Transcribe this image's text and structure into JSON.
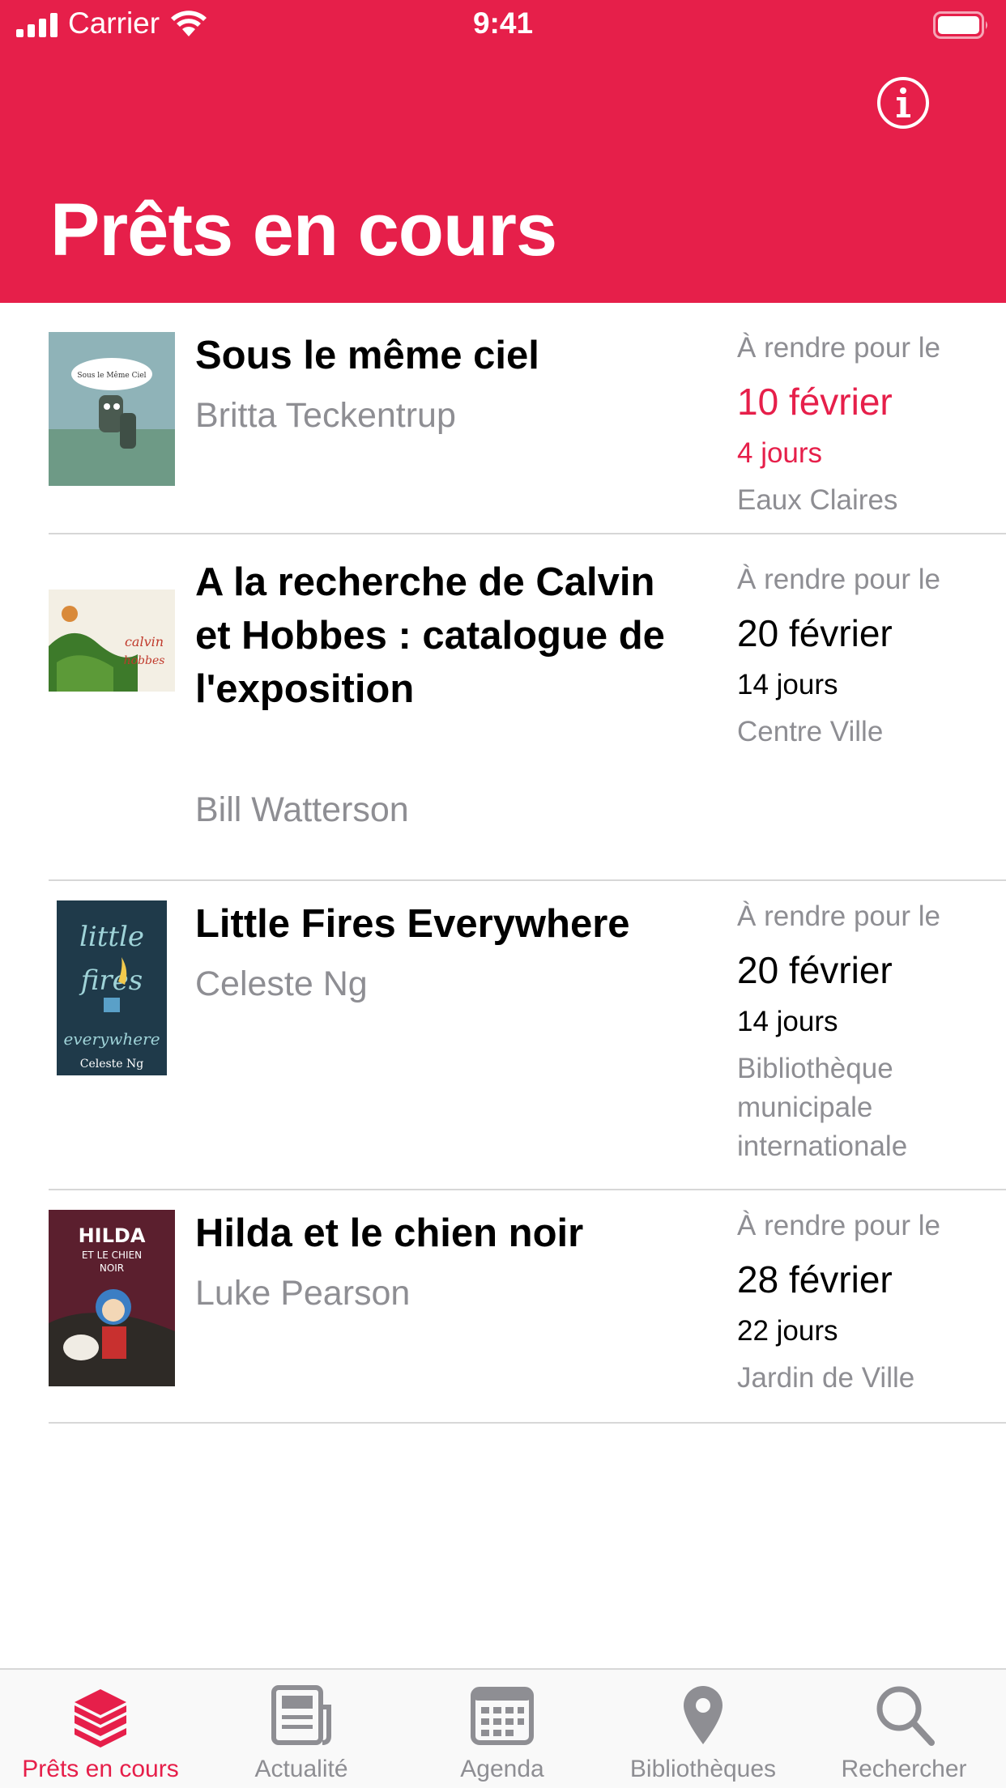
{
  "status_bar": {
    "carrier": "Carrier",
    "time": "9:41"
  },
  "header": {
    "title": "Prêts en cours",
    "info_icon": "info-circle-icon",
    "background": "#e61f4a"
  },
  "loans": [
    {
      "title": "Sous le même ciel",
      "author": "Britta Teckentrup",
      "due_label": "À rendre pour le",
      "due_date": "10 février",
      "due_days": "4 jours",
      "library": "Eaux Claires",
      "urgent": true,
      "cover_text": "Sous le Même Ciel"
    },
    {
      "title": "A la recherche de Calvin et Hobbes : catalogue de l'exposition",
      "author": "Bill Watterson",
      "due_label": "À rendre pour le",
      "due_date": "20 février",
      "due_days": "14 jours",
      "library": "Centre Ville",
      "urgent": false,
      "cover_text": "Calvin et Hobbes"
    },
    {
      "title": "Little Fires Everywhere",
      "author": "Celeste Ng",
      "due_label": "À rendre pour le",
      "due_date": "20 février",
      "due_days": "14 jours",
      "library": "Bibliothèque municipale internationale",
      "urgent": false,
      "cover_text": "little fires everywhere"
    },
    {
      "title": "Hilda et le chien noir",
      "author": "Luke Pearson",
      "due_label": "À rendre pour le",
      "due_date": "28 février",
      "due_days": "22 jours",
      "library": "Jardin de Ville",
      "urgent": false,
      "cover_text": "HILDA ET LE CHIEN NOIR"
    }
  ],
  "tabbar": {
    "items": [
      {
        "label": "Prêts en cours",
        "icon": "books-stack-icon",
        "active": true
      },
      {
        "label": "Actualité",
        "icon": "newspaper-icon",
        "active": false
      },
      {
        "label": "Agenda",
        "icon": "calendar-icon",
        "active": false
      },
      {
        "label": "Bibliothèques",
        "icon": "map-pin-icon",
        "active": false
      },
      {
        "label": "Rechercher",
        "icon": "search-icon",
        "active": false
      }
    ],
    "active_color": "#e61f4a",
    "inactive_color": "#8e8e93"
  }
}
